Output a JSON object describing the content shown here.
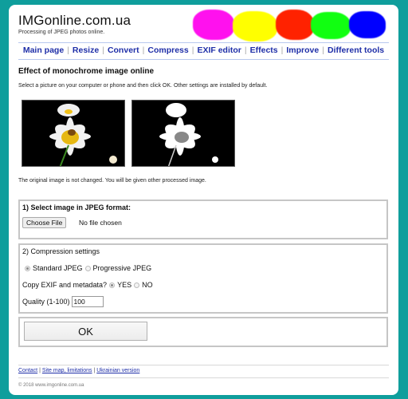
{
  "header": {
    "site_title": "IMGonline.com.ua",
    "subtitle": "Processing of JPEG photos online.",
    "blob_colors": [
      "#ff11ee",
      "#ffff00",
      "#ff2200",
      "#11ff11",
      "#0000ff"
    ]
  },
  "nav": {
    "items": [
      {
        "label": "Main page"
      },
      {
        "label": "Resize"
      },
      {
        "label": "Convert"
      },
      {
        "label": "Compress"
      },
      {
        "label": "EXIF editor"
      },
      {
        "label": "Effects"
      },
      {
        "label": "Improve"
      },
      {
        "label": "Different tools"
      }
    ],
    "separator": "|"
  },
  "main": {
    "title": "Effect of monochrome image online",
    "intro": "Select a picture on your computer or phone and then click OK. Other settings are installed by default.",
    "images": {
      "original_alt": "Daisy flowers on black background (original)",
      "processed_alt": "Daisy flowers monochrome (processed)"
    },
    "note": "The original image is not changed. You will be given other processed image."
  },
  "section1": {
    "title": "1) Select image in JPEG format:",
    "choose_file_label": "Choose File",
    "no_file_label": "No file chosen"
  },
  "section2": {
    "title": "2) Compression settings",
    "format_options": [
      {
        "label": "Standard JPEG",
        "selected": true
      },
      {
        "label": "Progressive JPEG",
        "selected": false
      }
    ],
    "exif_label": "Copy EXIF and metadata?",
    "exif_options": [
      {
        "label": "YES",
        "selected": true
      },
      {
        "label": "NO",
        "selected": false
      }
    ],
    "quality_label": "Quality (1-100)",
    "quality_value": "100"
  },
  "submit": {
    "ok_label": "OK"
  },
  "footer": {
    "links": [
      {
        "label": "Contact"
      },
      {
        "label": "Site map, limitations"
      },
      {
        "label": "Ukrainian version"
      }
    ],
    "separator": "|",
    "copyright": "© 2018 www.imgonline.com.ua"
  }
}
